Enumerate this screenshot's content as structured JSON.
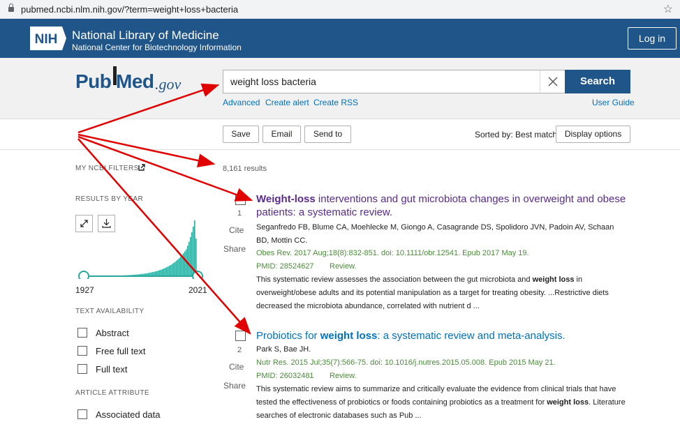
{
  "browser": {
    "url": "pubmed.ncbi.nlm.nih.gov/?term=weight+loss+bacteria",
    "icons": [
      "lock-icon",
      "star-icon"
    ]
  },
  "nih": {
    "logo_text": "NIH",
    "title": "National Library of Medicine",
    "subtitle": "National Center for Biotechnology Information",
    "login_label": "Log in"
  },
  "search": {
    "logo_pub": "Pub",
    "logo_med": "Med",
    "logo_gov": ".gov",
    "query": "weight loss bacteria",
    "button_label": "Search",
    "links": {
      "advanced": "Advanced",
      "create_alert": "Create alert",
      "create_rss": "Create RSS",
      "user_guide": "User Guide"
    }
  },
  "toolbar": {
    "save": "Save",
    "email": "Email",
    "send_to": "Send to",
    "sorted_by": "Sorted by: Best match",
    "display_options": "Display options"
  },
  "sidebar": {
    "my_ncbi_filters": "MY NCBI FILTERS",
    "results_by_year": "RESULTS BY YEAR",
    "year_start": "1927",
    "year_end": "2021",
    "text_availability": "TEXT AVAILABILITY",
    "text_filters": [
      "Abstract",
      "Free full text",
      "Full text"
    ],
    "article_attribute": "ARTICLE ATTRIBUTE",
    "attribute_filters": [
      "Associated data"
    ]
  },
  "results": {
    "count": "8,161 results",
    "items": [
      {
        "number": "1",
        "title_bold": "Weight-loss",
        "title_rest": " interventions and gut microbiota changes in overweight and obese patients: a systematic review.",
        "authors": "Seganfredo FB, Blume CA, Moehlecke M, Giongo A, Casagrande DS, Spolidoro JVN, Padoin AV, Schaan BD, Mottin CC.",
        "journal": "Obes Rev. 2017 Aug;18(8):832-851. doi: 10.1111/obr.12541. Epub 2017 May 19.",
        "pmid": "PMID: 28524627",
        "type": "Review.",
        "snippet_a": "This systematic review assesses the association between the gut microbiota and ",
        "snippet_bold": "weight loss",
        "snippet_b": " in overweight/obese adults and its potential manipulation as a target for treating obesity. ...Restrictive diets decreased the microbiota abundance, correlated with nutrient d ...",
        "cite": "Cite",
        "share": "Share"
      },
      {
        "number": "2",
        "title_pre": "Probiotics for ",
        "title_bold": "weight loss",
        "title_rest": ": a systematic review and meta-analysis.",
        "authors": "Park S, Bae JH.",
        "journal": "Nutr Res. 2015 Jul;35(7):566-75. doi: 10.1016/j.nutres.2015.05.008. Epub 2015 May 21.",
        "pmid": "PMID: 26032481",
        "type": "Review.",
        "snippet_a": "This systematic review aims to summarize and critically evaluate the evidence from clinical trials that have tested the effectiveness of probiotics or foods containing probiotics as a treatment for ",
        "snippet_bold": "weight loss",
        "snippet_b": ". Literature searches of electronic databases such as Pub ...",
        "cite": "Cite",
        "share": "Share"
      }
    ]
  },
  "colors": {
    "brand": "#20558a",
    "link": "#0071bc",
    "visited": "#5a2b8b",
    "journal": "#4b8b3b",
    "annotation_arrow": "#e00000"
  }
}
